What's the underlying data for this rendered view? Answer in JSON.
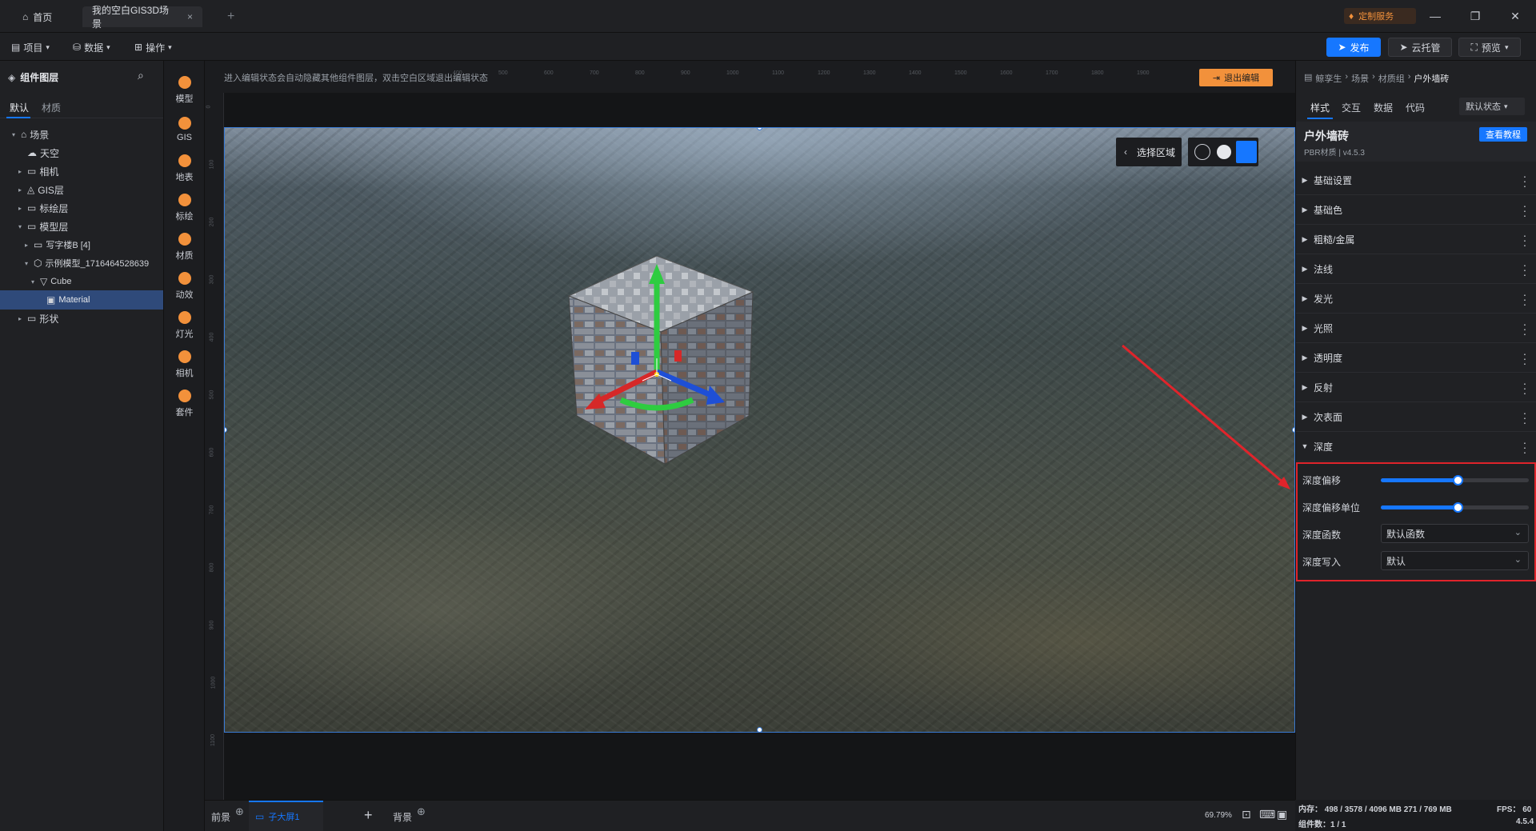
{
  "titlebar": {
    "tabs": [
      {
        "label": "首页",
        "icon": "home-icon"
      },
      {
        "label": "我的空白GIS3D场景",
        "icon": "close-icon"
      }
    ],
    "new_tab_icon": "plus-icon",
    "custom_service": "定制服务",
    "window_controls": [
      "minimize-icon",
      "restore-icon",
      "close-icon"
    ]
  },
  "menubar": {
    "menus": [
      "项目",
      "数据",
      "操作"
    ],
    "publish": "发布",
    "cloud_host": "云托管",
    "preview": "预览"
  },
  "left_panel": {
    "title": "组件图层",
    "tabs": [
      "默认",
      "材质"
    ],
    "tree": [
      {
        "label": "场景",
        "depth": 0,
        "caret": "down",
        "icon": "scene-icon"
      },
      {
        "label": "天空",
        "depth": 1,
        "caret": "",
        "icon": "sky-icon"
      },
      {
        "label": "相机",
        "depth": 1,
        "caret": "right",
        "icon": "folder-icon"
      },
      {
        "label": "GIS层",
        "depth": 1,
        "caret": "right",
        "icon": "gis-icon"
      },
      {
        "label": "标绘层",
        "depth": 1,
        "caret": "right",
        "icon": "folder-icon"
      },
      {
        "label": "模型层",
        "depth": 1,
        "caret": "down",
        "icon": "folder-icon"
      },
      {
        "label": "写字楼B [4]",
        "depth": 2,
        "caret": "right",
        "icon": "folder-icon"
      },
      {
        "label": "示例模型_1716464528639",
        "depth": 2,
        "caret": "down",
        "icon": "cube-icon"
      },
      {
        "label": "Cube",
        "depth": 3,
        "caret": "down",
        "icon": "mesh-icon"
      },
      {
        "label": "Material",
        "depth": 4,
        "caret": "",
        "icon": "material-icon",
        "selected": true
      },
      {
        "label": "形状",
        "depth": 1,
        "caret": "right",
        "icon": "folder-icon"
      }
    ]
  },
  "icon_strip": [
    {
      "label": "模型",
      "icon": "model-icon"
    },
    {
      "label": "GIS",
      "icon": "gis-icon"
    },
    {
      "label": "地表",
      "icon": "terrain-icon"
    },
    {
      "label": "标绘",
      "icon": "pin-icon"
    },
    {
      "label": "材质",
      "icon": "material-icon"
    },
    {
      "label": "动效",
      "icon": "effect-icon"
    },
    {
      "label": "灯光",
      "icon": "light-icon"
    },
    {
      "label": "相机",
      "icon": "camera-icon"
    },
    {
      "label": "套件",
      "icon": "kit-icon"
    }
  ],
  "canvas": {
    "hint": "进入编辑状态会自动隐藏其他组件图层，双击空白区域退出编辑状态",
    "exit_edit": "退出编辑",
    "select_area": "选择区域",
    "top_ticks": [
      "400",
      "500",
      "600",
      "700",
      "800",
      "900",
      "1000",
      "1100",
      "1200",
      "1300",
      "1400",
      "1500",
      "1600",
      "1700",
      "1800",
      "1900"
    ],
    "left_ticks": [
      "0",
      "100",
      "200",
      "300",
      "400",
      "500",
      "600",
      "700",
      "800",
      "900",
      "1000",
      "1100"
    ]
  },
  "bottom_bar": {
    "foreground": "前景",
    "screen_tab": "子大屏1",
    "background": "背景",
    "zoom": "69.79%"
  },
  "right_panel": {
    "breadcrumb": [
      "鲸孪生",
      "场景",
      "材质组",
      "户外墙砖"
    ],
    "tabs": [
      "样式",
      "交互",
      "数据",
      "代码"
    ],
    "state_select": "默认状态",
    "material_name": "户外墙砖",
    "material_sub": "PBR材质 | v4.5.3",
    "tutorial_button": "查看教程",
    "sections": [
      "基础设置",
      "基础色",
      "粗糙/金属",
      "法线",
      "发光",
      "光照",
      "透明度",
      "反射",
      "次表面",
      "深度"
    ],
    "depth": {
      "offset_label": "深度偏移",
      "offset_value": 0.52,
      "offset_unit_label": "深度偏移单位",
      "offset_unit_value": 0.52,
      "func_label": "深度函数",
      "func_value": "默认函数",
      "write_label": "深度写入",
      "write_value": "默认"
    }
  },
  "status": {
    "memory": "内存： 498 / 3578 / 4096 MB  271 / 769 MB",
    "fps": "FPS： 60",
    "components": "组件数：1 / 1",
    "version": "4.5.4"
  },
  "colors": {
    "accent": "#1677ff",
    "highlight": "#e0242b",
    "orange": "#f2913b"
  }
}
